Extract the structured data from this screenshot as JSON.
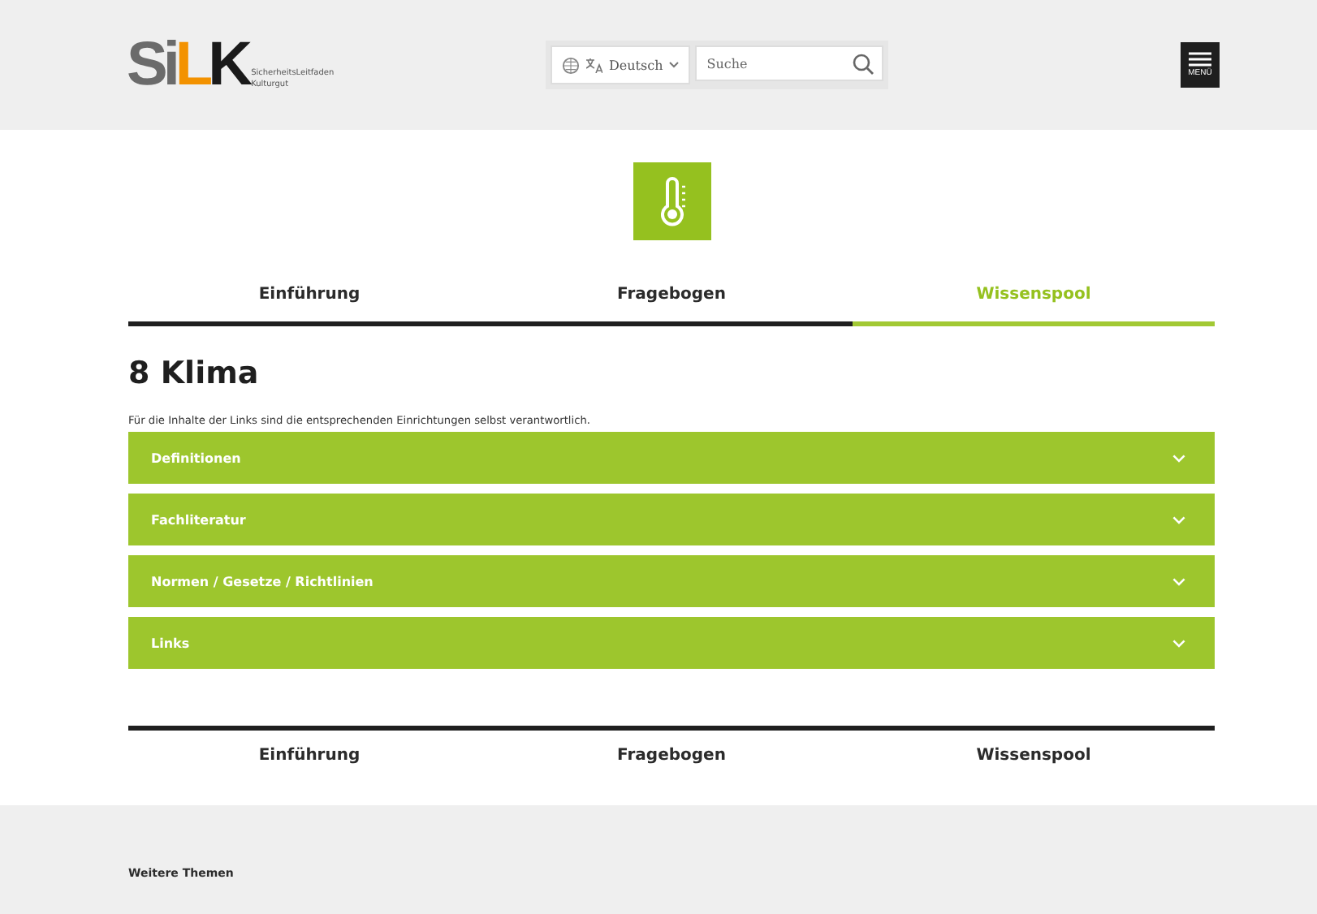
{
  "header": {
    "logo": {
      "letters": [
        {
          "text": "Si",
          "color": "#6b6b6b"
        },
        {
          "text": "L",
          "color": "#f39200"
        },
        {
          "text": "K",
          "color": "#1a1a1a"
        }
      ],
      "subtitle": [
        "SicherheitsLeitfaden",
        "Kulturgut"
      ]
    },
    "language": {
      "label": "Deutsch"
    },
    "search": {
      "placeholder": "Suche"
    },
    "menu_button": {
      "label": "MENÜ"
    }
  },
  "tabs": [
    {
      "label": "Einführung",
      "selected": false
    },
    {
      "label": "Fragebogen",
      "selected": false
    },
    {
      "label": "Wissenspool",
      "selected": true
    }
  ],
  "heading": "8 Klima",
  "note": "Für die Inhalte der Links sind die entsprechenden Einrichtungen selbst verantwortlich.",
  "sections": [
    {
      "label": "Definitionen",
      "expanded": false
    },
    {
      "label": "Fachliteratur",
      "expanded": false
    },
    {
      "label": "Normen / Gesetze / Richtlinien",
      "expanded": false
    },
    {
      "label": "Links",
      "expanded": false
    }
  ],
  "bottom_nav": [
    "Einführung",
    "Fragebogen",
    "Wissenspool"
  ],
  "footer": {
    "title": "Weitere Themen"
  }
}
